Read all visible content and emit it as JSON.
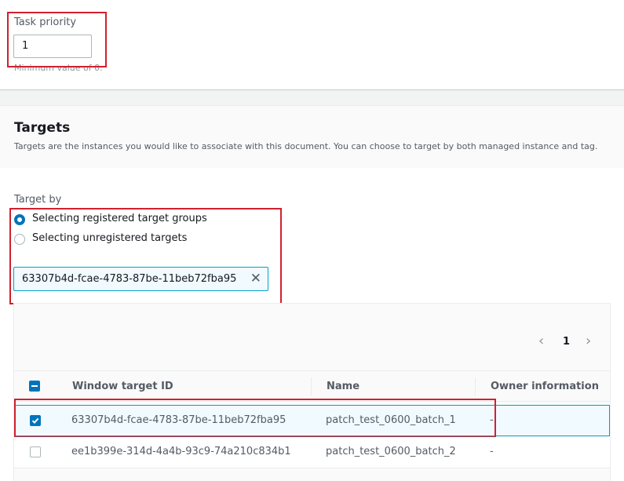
{
  "task_priority": {
    "label": "Task priority",
    "value": "1",
    "hint": "Minimum value of 0."
  },
  "targets_section": {
    "title": "Targets",
    "description": "Targets are the instances you would like to associate with this document. You can choose to target by both managed instance and tag."
  },
  "target_by": {
    "label": "Target by",
    "options": [
      {
        "label": "Selecting registered target groups",
        "checked": true
      },
      {
        "label": "Selecting unregistered targets",
        "checked": false
      }
    ],
    "token_value": "63307b4d-fcae-4783-87be-11beb72fba95"
  },
  "table": {
    "pagination": {
      "prev": "‹",
      "page": "1",
      "next": "›"
    },
    "columns": [
      "Window target ID",
      "Name",
      "Owner information"
    ],
    "rows": [
      {
        "id": "63307b4d-fcae-4783-87be-11beb72fba95",
        "name": "patch_test_0600_batch_1",
        "owner": "-",
        "selected": true
      },
      {
        "id": "ee1b399e-314d-4a4b-93c9-74a210c834b1",
        "name": "patch_test_0600_batch_2",
        "owner": "-",
        "selected": false
      }
    ]
  },
  "colors": {
    "accent": "#0073bb",
    "highlight": "#d1202f",
    "selected_row_border": "#00a1c9"
  },
  "icons": {
    "clear_token": "close-icon",
    "pager_prev": "chevron-left-icon",
    "pager_next": "chevron-right-icon",
    "checkmark": "check-icon"
  }
}
